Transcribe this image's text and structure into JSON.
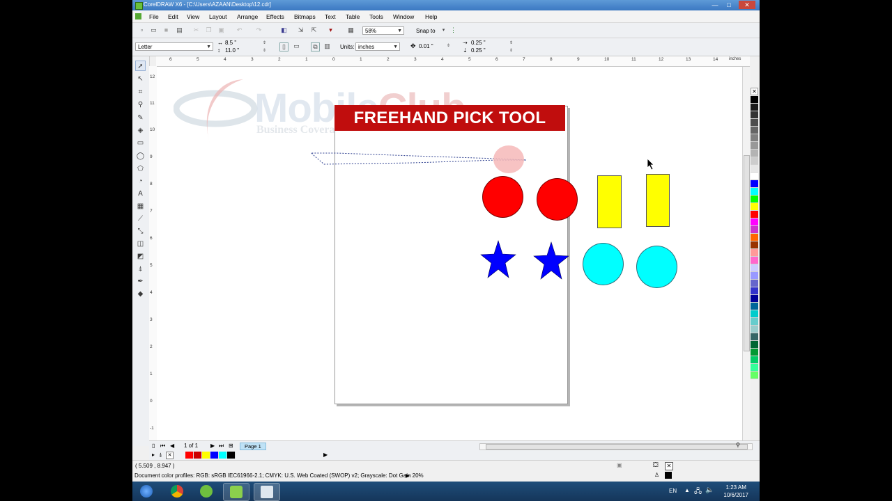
{
  "window": {
    "title": "CorelDRAW X6 - [C:\\Users\\AZAAN\\Desktop\\12.cdr]",
    "minimize": "—",
    "maximize": "□",
    "close": "✕"
  },
  "menu": [
    "File",
    "Edit",
    "View",
    "Layout",
    "Arrange",
    "Effects",
    "Bitmaps",
    "Text",
    "Table",
    "Tools",
    "Window",
    "Help"
  ],
  "toolbar": {
    "zoom": "58%",
    "snap_to": "Snap to"
  },
  "property_bar": {
    "paper": "Letter",
    "width": "8.5 \"",
    "height": "11.0 \"",
    "units_label": "Units:",
    "units": "inches",
    "nudge": "0.01 \"",
    "dup_x": "0.25 \"",
    "dup_y": "0.25 \""
  },
  "ruler": {
    "h_labels": [
      "6",
      "5",
      "4",
      "3",
      "2",
      "1",
      "0",
      "1",
      "2",
      "3",
      "4",
      "5",
      "6",
      "7",
      "8",
      "9",
      "10",
      "11",
      "12",
      "13",
      "14"
    ],
    "h_unit": "inches",
    "v_labels": [
      "12",
      "11",
      "10",
      "9",
      "8",
      "7",
      "6",
      "5",
      "4",
      "3",
      "2",
      "1",
      "0",
      "-1"
    ]
  },
  "document": {
    "banner": "FREEHAND PICK TOOL",
    "watermark_main": "Mobile",
    "watermark_club": "Club",
    "watermark_tag": "Business Coverage Made Easy"
  },
  "colors": {
    "banner": "#c00d0d",
    "circle_red": "#ff0000",
    "rect_yellow": "#ffff00",
    "star_blue": "#0000ff",
    "circle_cyan": "#00ffff",
    "palette": [
      "#000000",
      "#1a1a1a",
      "#333333",
      "#4d4d4d",
      "#666666",
      "#808080",
      "#999999",
      "#b3b3b3",
      "#cccccc",
      "#e6e6e6",
      "#ffffff",
      "#0000ff",
      "#00ffff",
      "#00ff00",
      "#ffff00",
      "#ff0000",
      "#ff00ff",
      "#cc33cc",
      "#ff6600",
      "#993300",
      "#ff9999",
      "#ff66cc",
      "#ccccff",
      "#9999ff",
      "#6666cc",
      "#3333cc",
      "#000099",
      "#006699",
      "#00cccc",
      "#66cccc",
      "#99cccc",
      "#336666",
      "#006633",
      "#009933",
      "#00cc66",
      "#33ff99",
      "#66ff66"
    ],
    "doc_palette": [
      "#ff0000",
      "#cc0000",
      "#ffff00",
      "#0000ff",
      "#00ffff",
      "#000000"
    ]
  },
  "page_nav": {
    "count": "1 of 1",
    "tab": "Page 1"
  },
  "status": {
    "coords": "( 5.509 , 8.947 )",
    "profile": "Document color profiles: RGB: sRGB IEC61966-2.1; CMYK: U.S. Web Coated (SWOP) v2; Grayscale: Dot Gain 20%"
  },
  "taskbar": {
    "lang": "EN",
    "time": "1:23 AM",
    "date": "10/6/2017"
  }
}
